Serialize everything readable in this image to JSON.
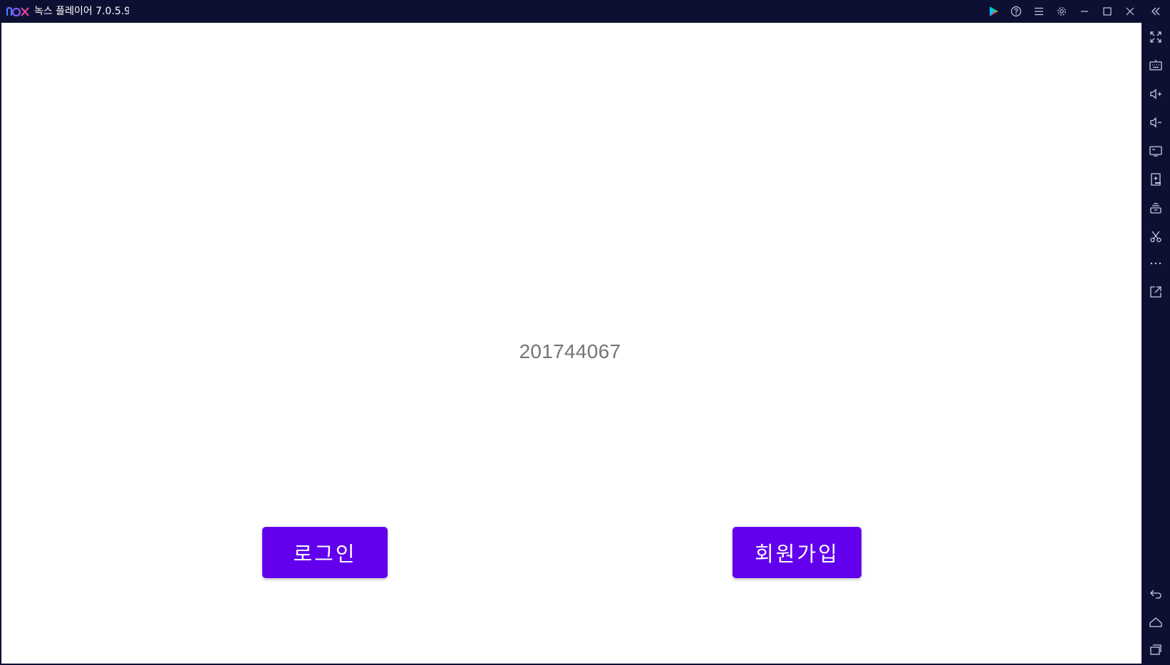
{
  "window": {
    "title": "녹스 플레이어 7.0.5.9",
    "logo_text": "nox"
  },
  "title_controls": [
    {
      "name": "play-store-icon"
    },
    {
      "name": "help-icon"
    },
    {
      "name": "menu-icon"
    },
    {
      "name": "settings-icon"
    },
    {
      "name": "minimize-icon"
    },
    {
      "name": "maximize-icon"
    },
    {
      "name": "close-icon"
    },
    {
      "name": "collapse-sidebar-icon"
    }
  ],
  "sidebar": [
    {
      "name": "fullscreen-icon"
    },
    {
      "name": "keyboard-icon"
    },
    {
      "name": "volume-up-icon"
    },
    {
      "name": "volume-down-icon"
    },
    {
      "name": "screen-icon"
    },
    {
      "name": "add-apk-icon"
    },
    {
      "name": "multi-instance-icon"
    },
    {
      "name": "scissors-icon"
    },
    {
      "name": "more-icon"
    },
    {
      "name": "external-link-icon"
    },
    {
      "name": "back-icon"
    },
    {
      "name": "home-icon"
    },
    {
      "name": "recent-apps-icon"
    }
  ],
  "app": {
    "student_id": "201744067",
    "login_label": "로그인",
    "signup_label": "회원가입"
  },
  "colors": {
    "accent": "#6200ee",
    "frame": "#0e1033",
    "text_gray": "#757575"
  }
}
